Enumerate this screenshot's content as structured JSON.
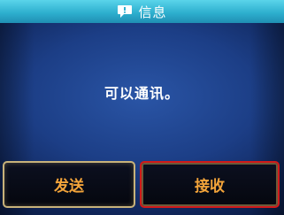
{
  "header": {
    "title": "信息",
    "icon": "message-bubble-icon",
    "color": "#2eb0cf"
  },
  "message": {
    "text": "可以通讯。"
  },
  "buttons": {
    "send_label": "发送",
    "receive_label": "接收"
  },
  "colors": {
    "background": "#1c3e86",
    "button_text": "#f3a43a",
    "selected_border": "#d11a1a"
  }
}
